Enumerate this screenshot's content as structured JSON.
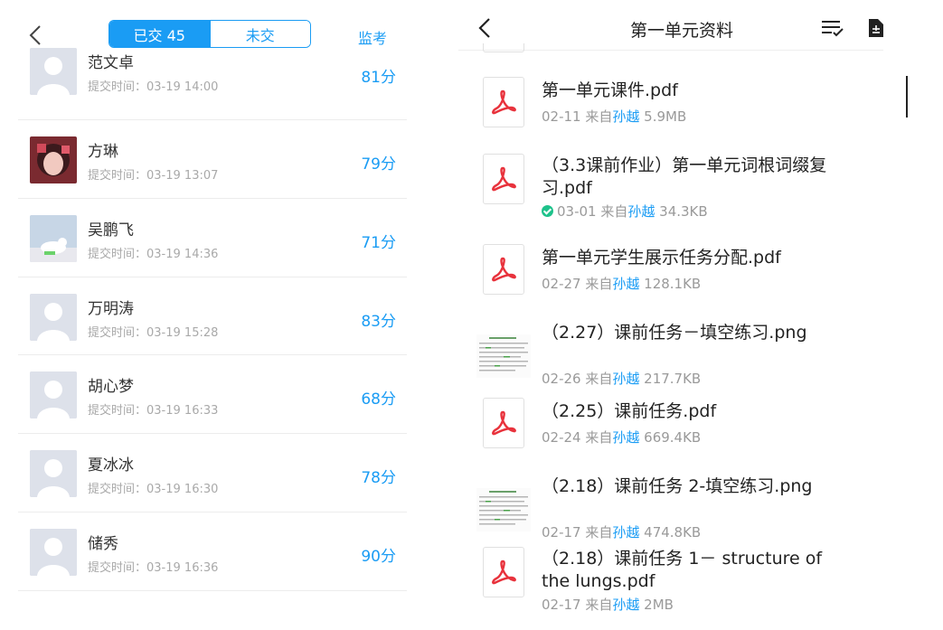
{
  "left": {
    "segment": {
      "submitted": "已交 45",
      "not_submitted": "未交"
    },
    "proctor_label": "监考",
    "time_prefix": "提交时间：",
    "students": [
      {
        "name": "范文卓",
        "time": "03-19 14:00",
        "score": "81分",
        "avatar": "default"
      },
      {
        "name": "方琳",
        "time": "03-19 13:07",
        "score": "79分",
        "avatar": "photo"
      },
      {
        "name": "吴鹏飞",
        "time": "03-19 14:36",
        "score": "71分",
        "avatar": "cartoon"
      },
      {
        "name": "万明涛",
        "time": "03-19 15:28",
        "score": "83分",
        "avatar": "default"
      },
      {
        "name": "胡心梦",
        "time": "03-19 16:33",
        "score": "68分",
        "avatar": "default"
      },
      {
        "name": "夏冰冰",
        "time": "03-19 16:30",
        "score": "78分",
        "avatar": "default"
      },
      {
        "name": "储秀",
        "time": "03-19 16:36",
        "score": "90分",
        "avatar": "default"
      }
    ]
  },
  "right": {
    "title": "第一单元资料",
    "from_label": "来自",
    "files": [
      {
        "name": "第一单元课件.pdf",
        "date": "02-11",
        "who": "孙越",
        "size": "5.9MB",
        "type": "pdf",
        "checked": false
      },
      {
        "name": "（3.3课前作业）第一单元词根词缀复习.pdf",
        "date": "03-01",
        "who": "孙越",
        "size": "34.3KB",
        "type": "pdf",
        "checked": true
      },
      {
        "name": "第一单元学生展示任务分配.pdf",
        "date": "02-27",
        "who": "孙越",
        "size": "128.1KB",
        "type": "pdf",
        "checked": false
      },
      {
        "name": "（2.27）课前任务－填空练习.png",
        "date": "02-26",
        "who": "孙越",
        "size": "217.7KB",
        "type": "png",
        "checked": false
      },
      {
        "name": "（2.25）课前任务.pdf",
        "date": "02-24",
        "who": "孙越",
        "size": "669.4KB",
        "type": "pdf",
        "checked": false
      },
      {
        "name": "（2.18）课前任务 2-填空练习.png",
        "date": "02-17",
        "who": "孙越",
        "size": "474.8KB",
        "type": "png",
        "checked": false
      },
      {
        "name": "（2.18）课前任务 1－ structure of the lungs.pdf",
        "date": "02-17",
        "who": "孙越",
        "size": "2MB",
        "type": "pdf",
        "checked": false
      }
    ]
  },
  "colors": {
    "accent": "#1a9cf4",
    "pdf_red": "#e8323c",
    "check_green": "#1ec28b"
  }
}
